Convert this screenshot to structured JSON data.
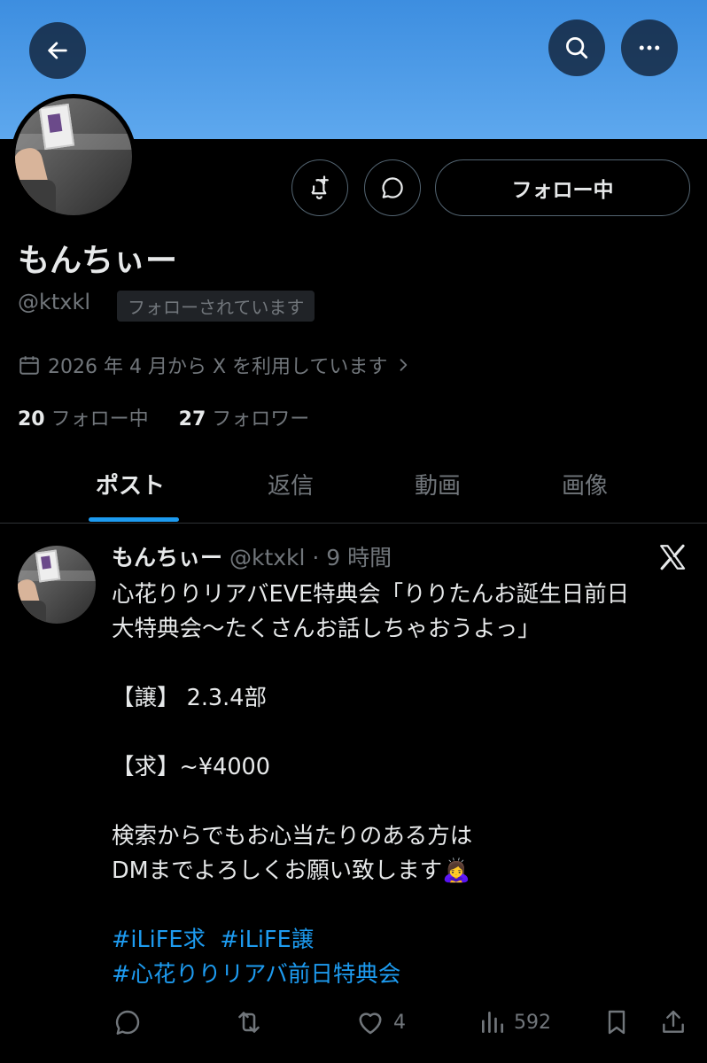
{
  "profile": {
    "name": "もんちぃー",
    "handle": "@ktxkl",
    "follows_you_badge": "フォローされています",
    "joined": "2026 年 4 月から X を利用しています",
    "following_count": "20",
    "following_label": "フォロー中",
    "followers_count": "27",
    "followers_label": "フォロワー",
    "follow_button_label": "フォロー中"
  },
  "tabs": [
    "ポスト",
    "返信",
    "動画",
    "画像"
  ],
  "active_tab": 0,
  "post": {
    "author_name": "もんちぃー",
    "author_meta": "@ktxkl · 9 時間",
    "lines": [
      "心花りりリアバEVE特典会「りりたんお誕生日前日",
      "大特典会〜たくさんお話しちゃおうよっ」",
      "",
      "【譲】 2.3.4部",
      "",
      "【求】~¥4000",
      "",
      "検索からでもお心当たりのある方は",
      "DMまでよろしくお願い致します🙇‍♀️"
    ],
    "hashtags": [
      "#iLiFE求",
      "#iLiFE譲",
      "#心花りりリアバ前日特典会"
    ],
    "likes": "4",
    "views": "592"
  },
  "colors": {
    "accent": "#1d9bf0",
    "banner": "#4a9ae6",
    "background": "#000000",
    "secondary_text": "#71767b"
  },
  "icons": [
    "back-arrow-icon",
    "search-icon",
    "more-icon",
    "notification-bell-plus-icon",
    "message-bubble-icon",
    "calendar-icon",
    "chevron-right-icon",
    "x-logo-icon",
    "reply-icon",
    "repost-icon",
    "like-icon",
    "views-icon",
    "bookmark-icon",
    "share-icon"
  ]
}
